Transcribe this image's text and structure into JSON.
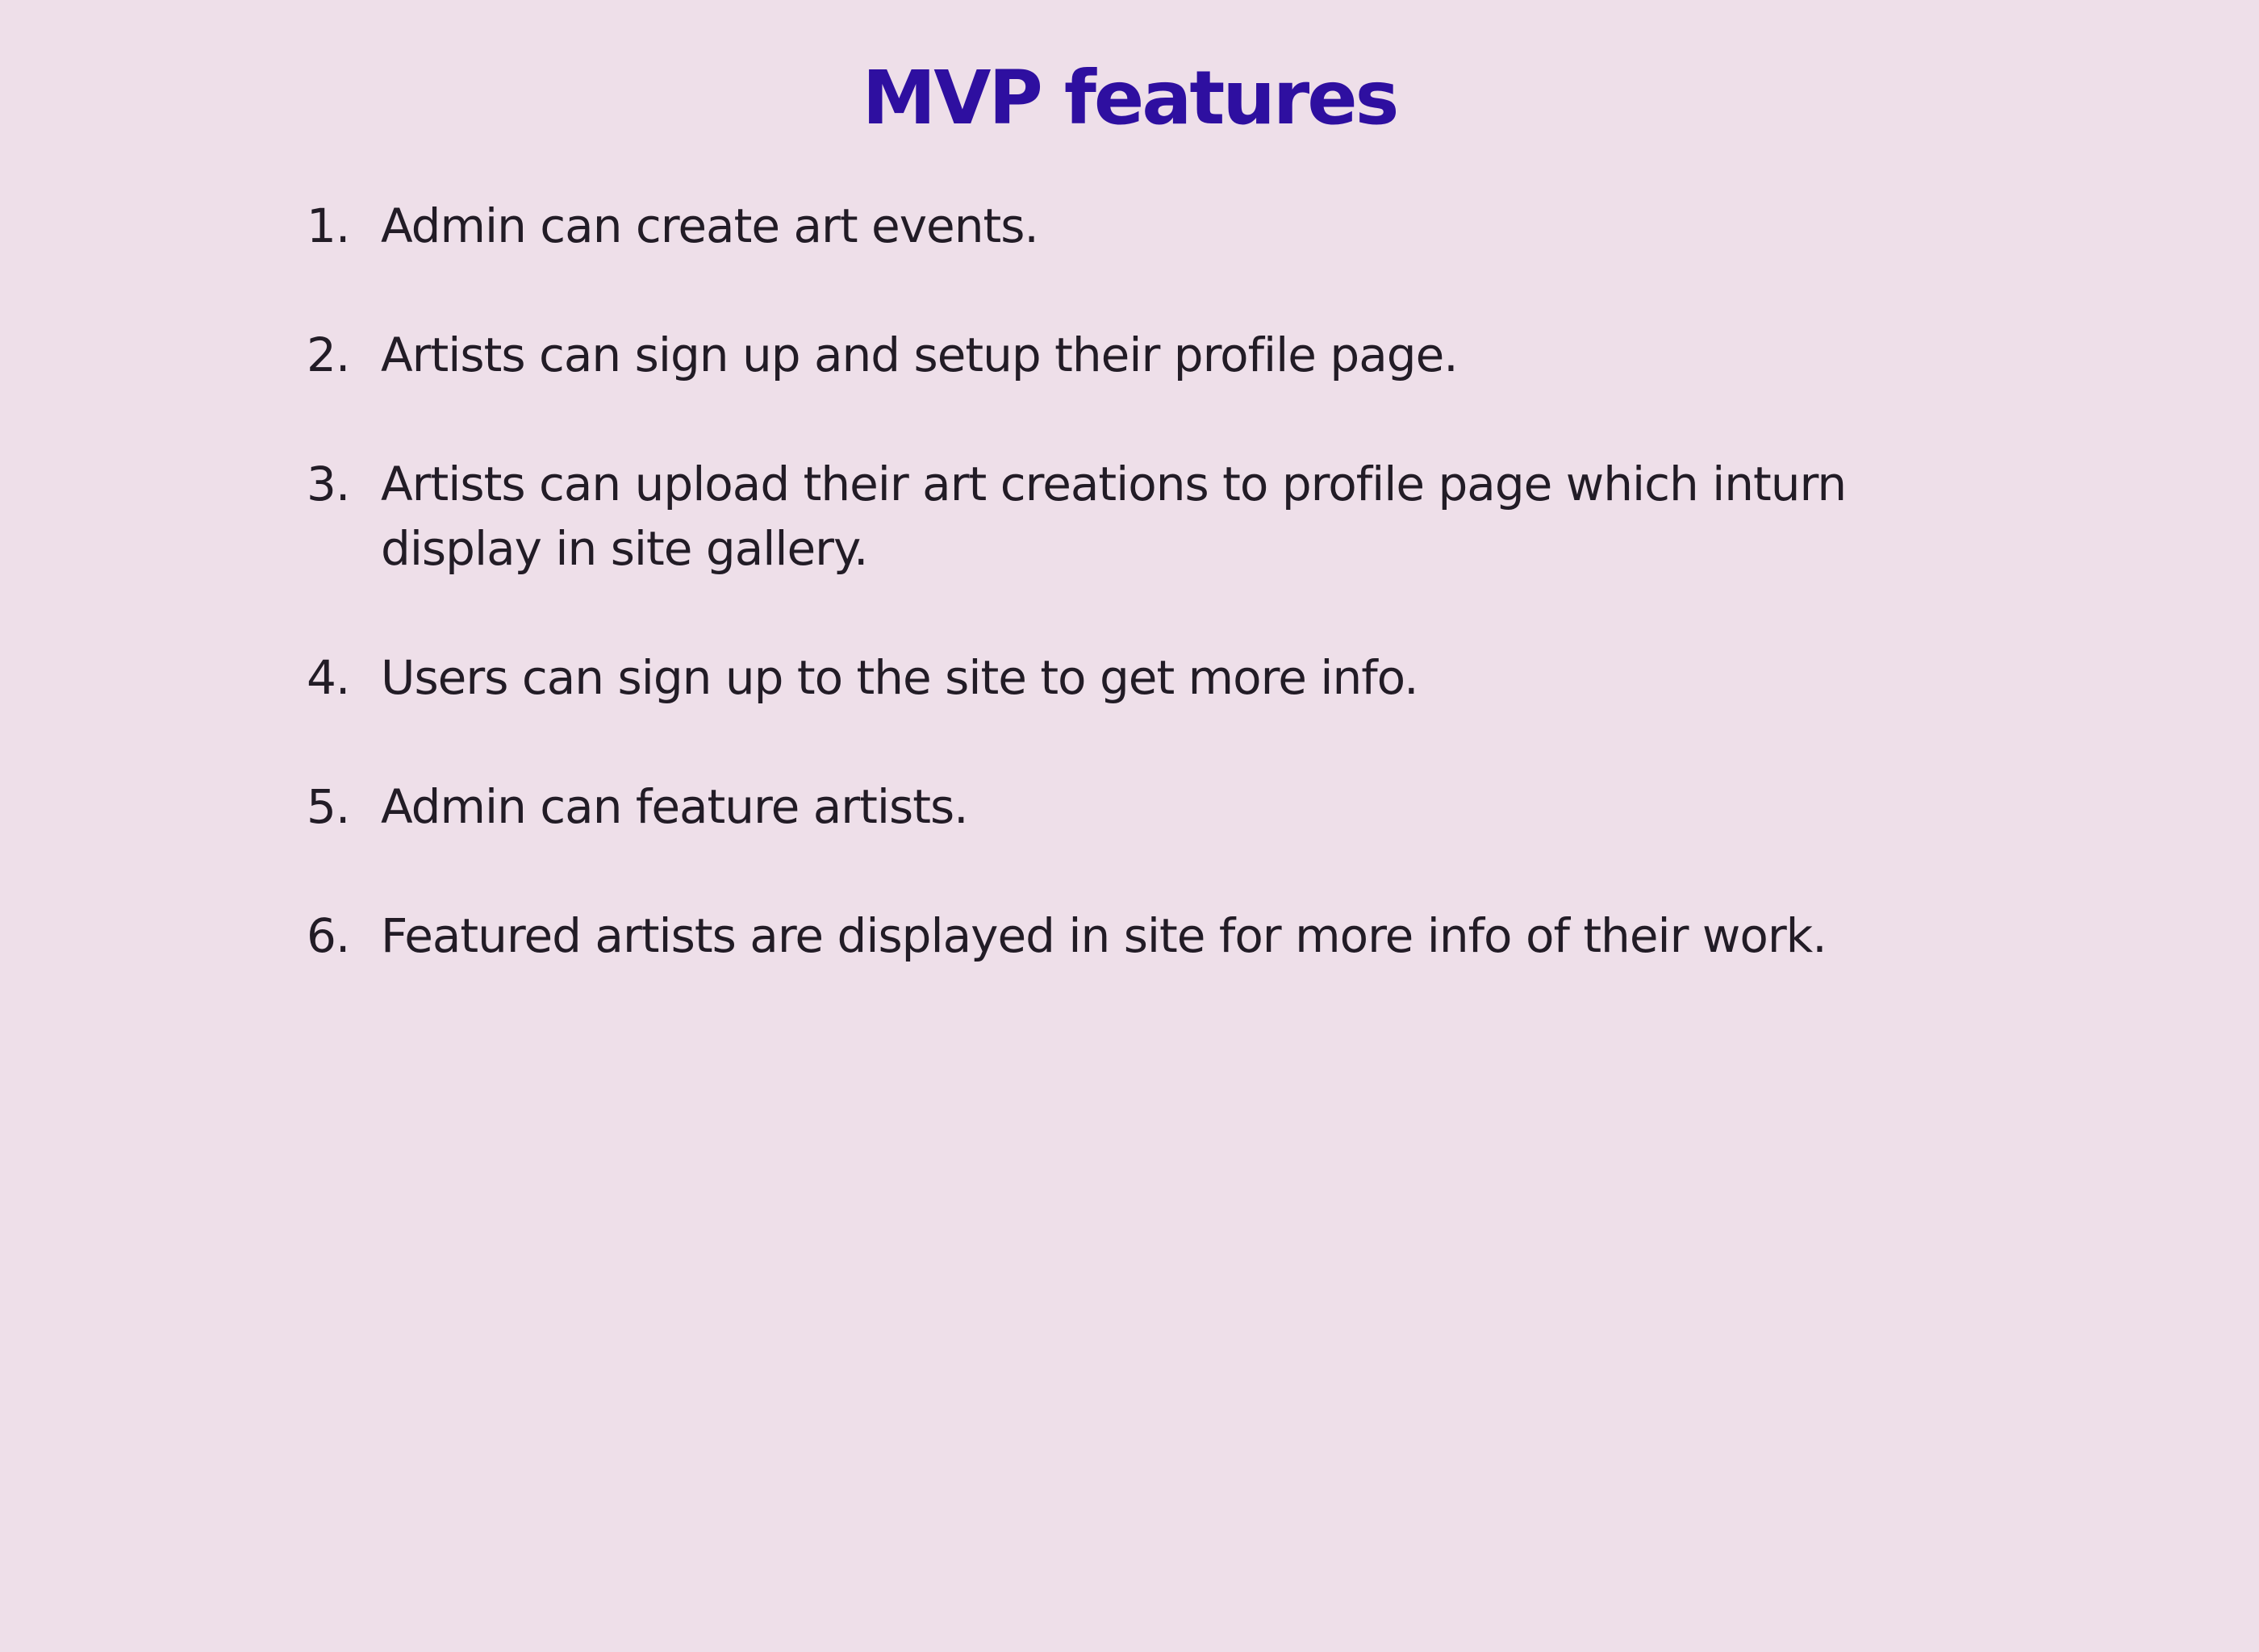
{
  "slide": {
    "title": "MVP features",
    "items": [
      {
        "number": "1.",
        "text": "Admin can create art events."
      },
      {
        "number": "2.",
        "text": "Artists can sign up and setup their profile page."
      },
      {
        "number": "3.",
        "text": "Artists can upload their art creations to profile page which inturn display in site gallery."
      },
      {
        "number": "4.",
        "text": "Users can sign up to the site to get more info."
      },
      {
        "number": "5.",
        "text": "Admin can feature artists."
      },
      {
        "number": "6.",
        "text": "Featured artists are displayed in site for more info of their work."
      }
    ]
  },
  "colors": {
    "background": "#eedfe9",
    "title": "#2e0fa0",
    "text": "#221c26"
  }
}
